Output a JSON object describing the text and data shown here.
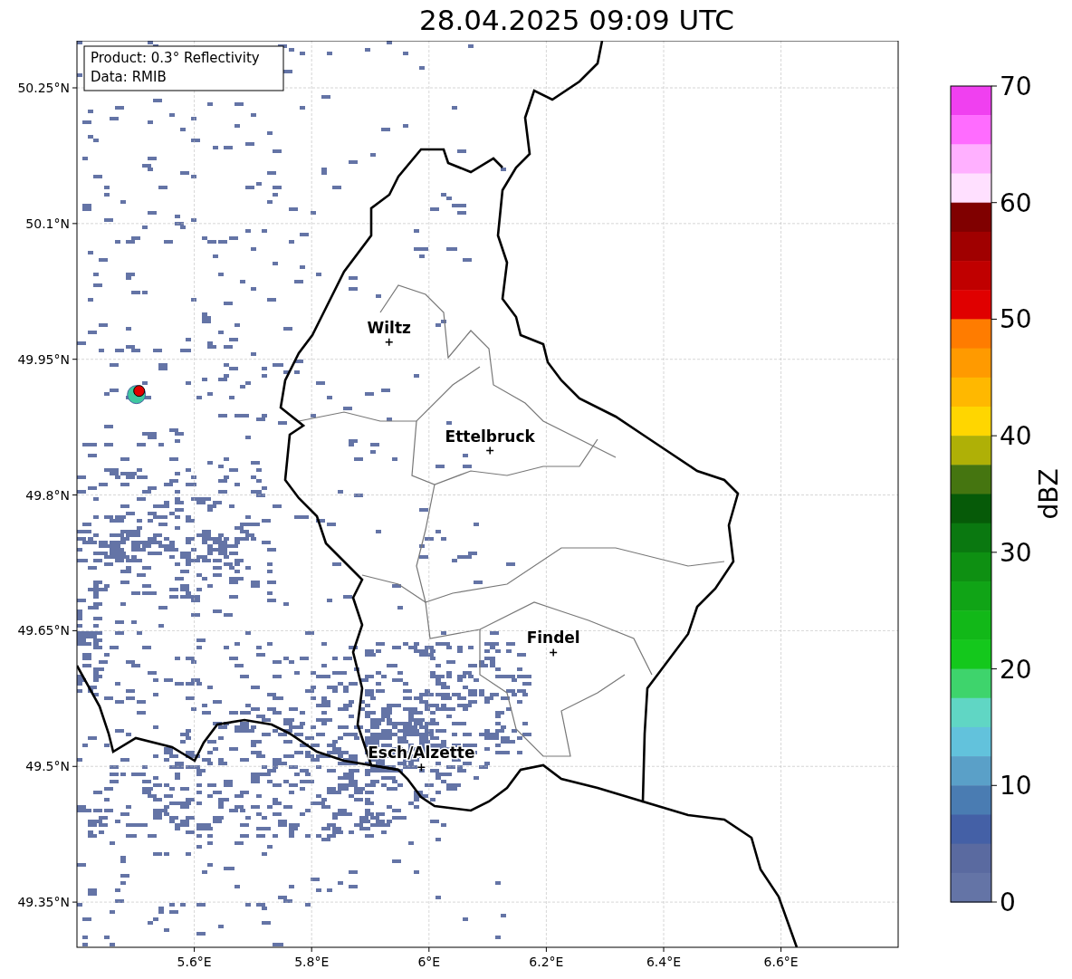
{
  "title": "28.04.2025 09:09 UTC",
  "info_box": {
    "lines": [
      "Product: 0.3° Reflectivity",
      "Data: RMIB"
    ]
  },
  "map": {
    "xticks": [
      "5.6°E",
      "5.8°E",
      "6°E",
      "6.2°E",
      "6.4°E",
      "6.6°E"
    ],
    "yticks": [
      "50.25°N",
      "50.1°N",
      "49.95°N",
      "49.8°N",
      "49.65°N",
      "49.5°N",
      "49.35°N"
    ],
    "cities": [
      "Wiltz",
      "Ettelbruck",
      "Findel",
      "Esch/Alzette"
    ]
  },
  "colorbar": {
    "label": "dBZ",
    "ticks": [
      "70",
      "60",
      "50",
      "40",
      "30",
      "20",
      "10",
      "0"
    ],
    "bands": [
      {
        "color": "#f040f0"
      },
      {
        "color": "#ff6cff"
      },
      {
        "color": "#ffb0ff"
      },
      {
        "color": "#ffe0ff"
      },
      {
        "color": "#800000"
      },
      {
        "color": "#a00000"
      },
      {
        "color": "#c00000"
      },
      {
        "color": "#e00000"
      },
      {
        "color": "#ff7c00"
      },
      {
        "color": "#ff9a00"
      },
      {
        "color": "#ffb800"
      },
      {
        "color": "#ffd600"
      },
      {
        "color": "#afb006"
      },
      {
        "color": "#457510"
      },
      {
        "color": "#065a08"
      },
      {
        "color": "#0a7810"
      },
      {
        "color": "#0e9012"
      },
      {
        "color": "#10a416"
      },
      {
        "color": "#12b818"
      },
      {
        "color": "#14c81c"
      },
      {
        "color": "#3ed46c"
      },
      {
        "color": "#60d6c4"
      },
      {
        "color": "#62c2dc"
      },
      {
        "color": "#5aa0c8"
      },
      {
        "color": "#4a7cb2"
      },
      {
        "color": "#4460a6"
      },
      {
        "color": "#5a6aa0"
      },
      {
        "color": "#6474a6"
      }
    ]
  }
}
